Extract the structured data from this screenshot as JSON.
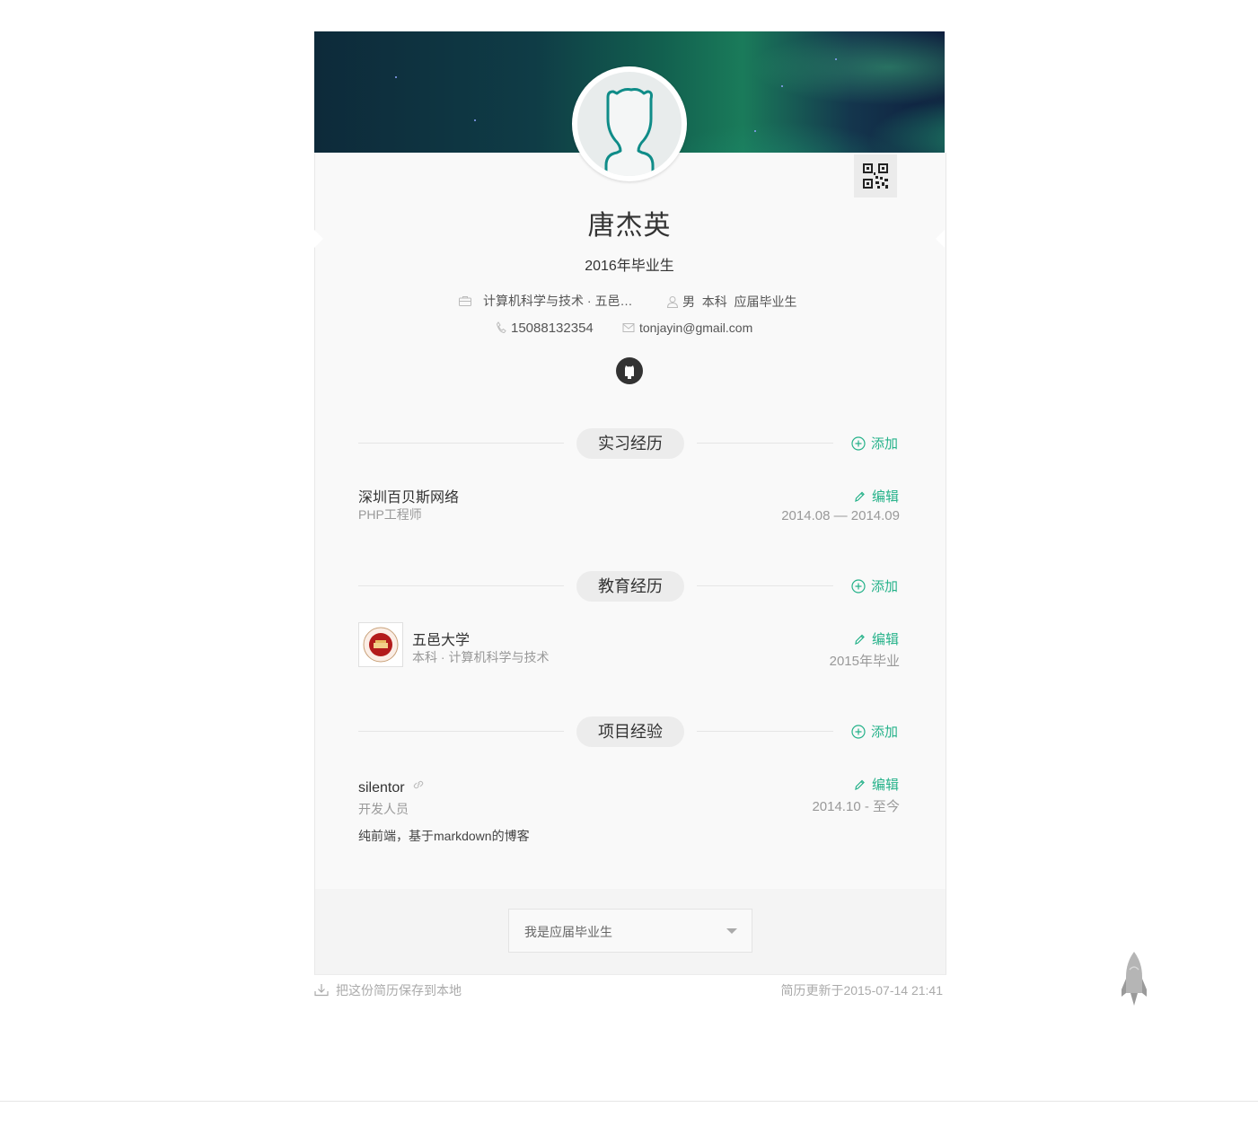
{
  "profile": {
    "name": "唐杰英",
    "subtitle": "2016年毕业生",
    "school_major": "计算机科学与技术 · 五邑…",
    "personal": "男  本科  应届毕业生",
    "phone": "15088132354",
    "email": "tonjayin@gmail.com"
  },
  "sections": {
    "internship": {
      "title": "实习经历",
      "add_label": "添加",
      "items": [
        {
          "company": "深圳百贝斯网络",
          "role": "PHP工程师",
          "edit_label": "编辑",
          "period": "2014.08 — 2014.09"
        }
      ]
    },
    "education": {
      "title": "教育经历",
      "add_label": "添加",
      "items": [
        {
          "school": "五邑大学",
          "detail": "本科 · 计算机科学与技术",
          "edit_label": "编辑",
          "period": "2015年毕业"
        }
      ]
    },
    "projects": {
      "title": "项目经验",
      "add_label": "添加",
      "items": [
        {
          "name": "silentor",
          "role": "开发人员",
          "edit_label": "编辑",
          "period": "2014.10 - 至今",
          "description": "纯前端，基于markdown的博客"
        }
      ]
    }
  },
  "status_select": {
    "value": "我是应届毕业生"
  },
  "footer": {
    "download_label": "把这份简历保存到本地",
    "updated_label": "简历更新于2015-07-14 21:41"
  },
  "icons": {
    "briefcase": "briefcase-icon",
    "person": "person-icon",
    "phone": "phone-icon",
    "mail": "mail-icon",
    "github": "github-icon",
    "plus": "plus-circle-icon",
    "pencil": "pencil-icon",
    "link": "link-icon",
    "download": "download-icon",
    "rocket": "rocket-icon",
    "qr": "qr-code-icon"
  },
  "colors": {
    "accent": "#26b28a",
    "card_bg": "#f9f9f9",
    "pill_bg": "#ececec"
  }
}
